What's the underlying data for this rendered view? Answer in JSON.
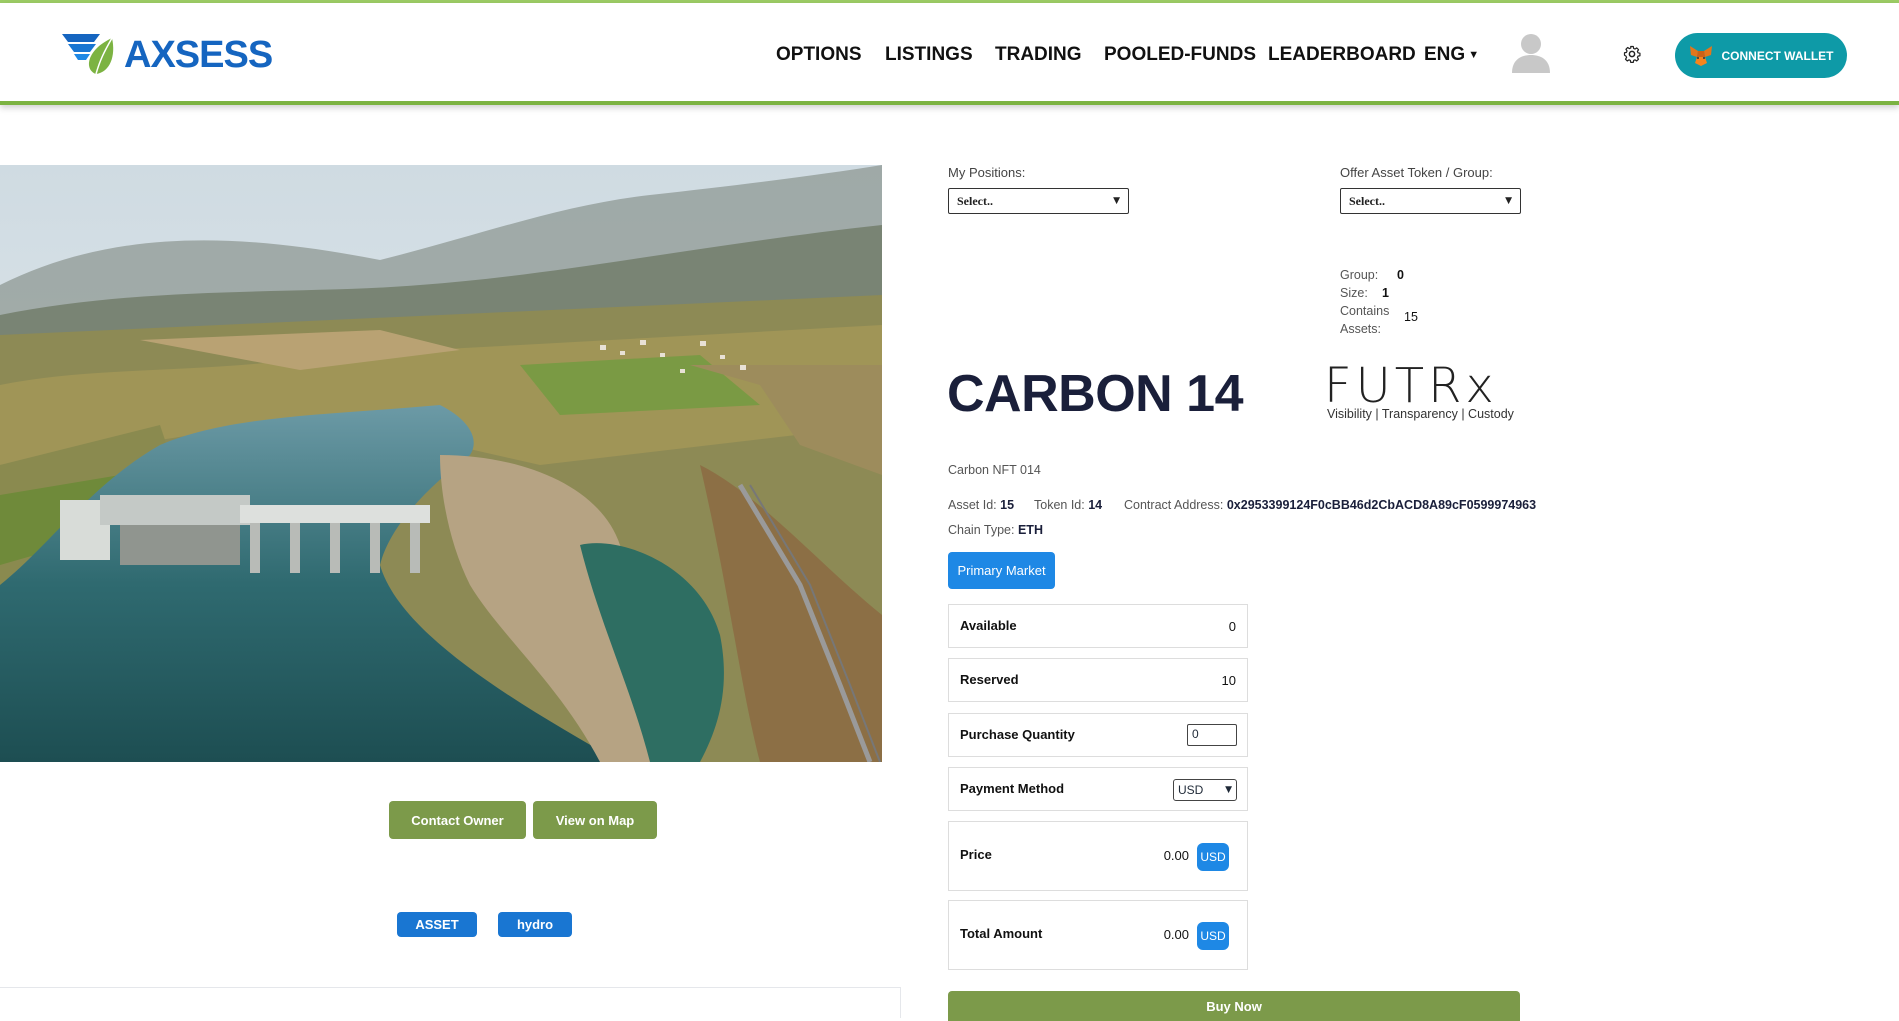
{
  "header": {
    "logo_text": "AXSESS",
    "nav": [
      "OPTIONS",
      "LISTINGS",
      "TRADING",
      "POOLED-FUNDS",
      "LEADERBOARD",
      "ENG"
    ],
    "connect_wallet": "CONNECT WALLET"
  },
  "hero": {
    "contact_owner": "Contact Owner",
    "view_on_map": "View on Map",
    "tags": [
      "ASSET",
      "hydro"
    ]
  },
  "positions": {
    "my_positions_label": "My Positions:",
    "my_positions_value": "Select..",
    "offer_label": "Offer Asset Token / Group:",
    "offer_value": "Select.."
  },
  "group_info": {
    "group_label": "Group:",
    "group_value": "0",
    "size_label": "Size:",
    "size_value": "1",
    "contains_label_1": "Contains",
    "contains_label_2": "Assets:",
    "contains_value": "15"
  },
  "asset": {
    "title": "CARBON 14",
    "partner_logo": "FUTRx",
    "partner_tagline": "Visibility | Transparency | Custody",
    "name": "Carbon NFT 014",
    "asset_id_label": "Asset Id:",
    "asset_id": "15",
    "token_id_label": "Token Id:",
    "token_id": "14",
    "contract_label": "Contract Address:",
    "contract": "0x2953399124F0cBB46d2CbACD8A89cF0599974963",
    "chain_label": "Chain Type:",
    "chain": "ETH"
  },
  "market": {
    "primary_market": "Primary Market",
    "available_label": "Available",
    "available": "0",
    "reserved_label": "Reserved",
    "reserved": "10",
    "purchase_label": "Purchase Quantity",
    "purchase_value": "0",
    "payment_label": "Payment Method",
    "payment_value": "USD",
    "price_label": "Price",
    "price": "0.00",
    "price_currency": "USD",
    "total_label": "Total Amount",
    "total": "0.00",
    "total_currency": "USD",
    "buy_now": "Buy Now"
  },
  "colors": {
    "accent_green": "#7c9a4a",
    "accent_blue": "#1e88e5",
    "wallet_teal": "#0e9aa7",
    "title_navy": "#1a1f3a"
  }
}
